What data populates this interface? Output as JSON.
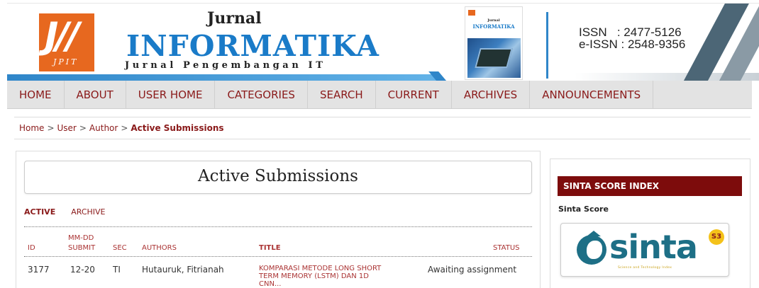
{
  "header": {
    "logo_text": "J//",
    "logo_subtext": "JPIT",
    "title_small": "Jurnal",
    "title_big": "INFORMATIKA",
    "title_sub": "Jurnal Pengembangan IT",
    "cover": {
      "title_small": "Jurnal",
      "title_big": "INFORMATIKA"
    },
    "issn_label": "ISSN",
    "issn_value": ": 2477-5126",
    "eissn_label": "e-ISSN",
    "eissn_value": ": 2548-9356"
  },
  "nav": {
    "items": [
      {
        "label": "HOME"
      },
      {
        "label": "ABOUT"
      },
      {
        "label": "USER HOME"
      },
      {
        "label": "CATEGORIES"
      },
      {
        "label": "SEARCH"
      },
      {
        "label": "CURRENT"
      },
      {
        "label": "ARCHIVES"
      },
      {
        "label": "ANNOUNCEMENTS"
      }
    ]
  },
  "breadcrumb": {
    "home": "Home",
    "user": "User",
    "author": "Author",
    "separator": ">",
    "current": "Active Submissions"
  },
  "main": {
    "page_title": "Active Submissions",
    "tabs": {
      "active": "ACTIVE",
      "archive": "ARCHIVE"
    },
    "table": {
      "headers": {
        "id": "ID",
        "submit_top": "MM-DD",
        "submit_bottom": "SUBMIT",
        "sec": "SEC",
        "authors": "AUTHORS",
        "title": "TITLE",
        "status": "STATUS"
      },
      "rows": [
        {
          "id": "3177",
          "submit": "12-20",
          "sec": "TI",
          "authors": "Hutauruk, Fitrianah",
          "title_line1": "KOMPARASI METODE LONG SHORT",
          "title_line2": "TERM MEMORY (LSTM) DAN 1D",
          "title_line3": "CNN...",
          "status": "Awaiting assignment"
        }
      ]
    }
  },
  "sidebar": {
    "sinta_header": "SINTA SCORE INDEX",
    "sinta_score_label": "Sinta Score",
    "sinta_logo_word": "sinta",
    "sinta_tagline": "Science and Technology Index",
    "sinta_rank": "S3"
  },
  "colors": {
    "accent": "#8a1a1a",
    "brand_blue": "#1a7bc8",
    "sinta_header_bg": "#7d0c0c",
    "logo_orange": "#e7681f"
  }
}
